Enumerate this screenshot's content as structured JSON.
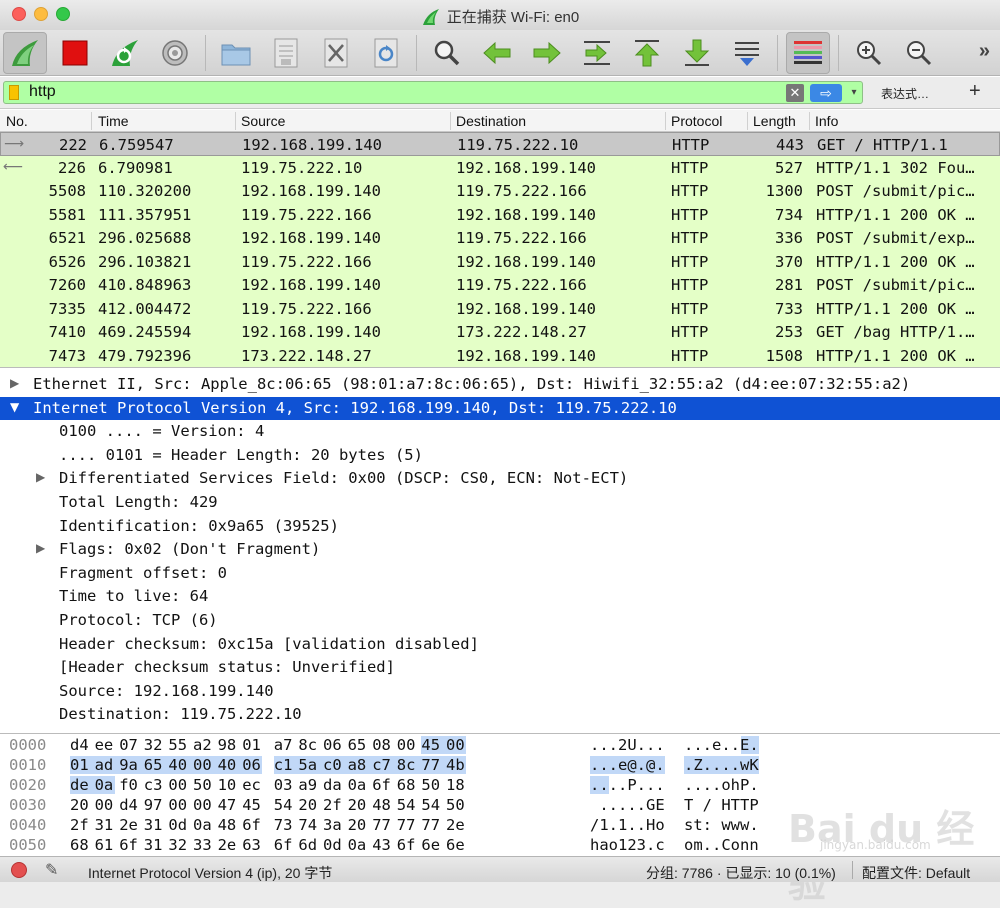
{
  "window": {
    "title": "正在捕获 Wi-Fi: en0"
  },
  "toolbar": {
    "buttons": [
      {
        "name": "start-capture",
        "icon": "shark-fin-icon"
      },
      {
        "name": "stop-capture",
        "icon": "red-square-stop-icon"
      },
      {
        "name": "restart-capture",
        "icon": "restart-fin-icon"
      },
      {
        "name": "capture-options",
        "icon": "gear-icon"
      },
      {
        "name": "open-file",
        "icon": "folder-icon"
      },
      {
        "name": "save-file",
        "icon": "file-save-icon"
      },
      {
        "name": "close-file",
        "icon": "file-close-icon"
      },
      {
        "name": "reload-file",
        "icon": "reload-icon"
      },
      {
        "name": "find-packet",
        "icon": "magnifier-icon"
      },
      {
        "name": "go-back",
        "icon": "arrow-left-icon"
      },
      {
        "name": "go-forward",
        "icon": "arrow-right-icon"
      },
      {
        "name": "go-to-packet",
        "icon": "goto-packet-icon"
      },
      {
        "name": "first-packet",
        "icon": "arrow-top-icon"
      },
      {
        "name": "last-packet",
        "icon": "arrow-bottom-icon"
      },
      {
        "name": "auto-scroll",
        "icon": "autoscroll-icon"
      },
      {
        "name": "colorize",
        "icon": "colorize-icon"
      },
      {
        "name": "zoom-in",
        "icon": "zoom-in-icon"
      },
      {
        "name": "zoom-out",
        "icon": "zoom-out-icon"
      }
    ],
    "more": "»"
  },
  "filter": {
    "value": "http",
    "expression_label": "表达式…",
    "add_label": "+",
    "clear_glyph": "✕",
    "apply_glyph": "⇨",
    "dropdown_glyph": "▾"
  },
  "packet_list": {
    "columns": [
      "No.",
      "Time",
      "Source",
      "Destination",
      "Protocol",
      "Length",
      "Info"
    ],
    "rows": [
      {
        "no": "222",
        "time": "6.759547",
        "src": "192.168.199.140",
        "dst": "119.75.222.10",
        "proto": "HTTP",
        "len": "443",
        "info": "GET / HTTP/1.1",
        "mark": "⟶"
      },
      {
        "no": "226",
        "time": "6.790981",
        "src": "119.75.222.10",
        "dst": "192.168.199.140",
        "proto": "HTTP",
        "len": "527",
        "info": "HTTP/1.1 302 Fou…",
        "mark": "⟵"
      },
      {
        "no": "5508",
        "time": "110.320200",
        "src": "192.168.199.140",
        "dst": "119.75.222.166",
        "proto": "HTTP",
        "len": "1300",
        "info": "POST /submit/pic…",
        "mark": ""
      },
      {
        "no": "5581",
        "time": "111.357951",
        "src": "119.75.222.166",
        "dst": "192.168.199.140",
        "proto": "HTTP",
        "len": "734",
        "info": "HTTP/1.1 200 OK …",
        "mark": ""
      },
      {
        "no": "6521",
        "time": "296.025688",
        "src": "192.168.199.140",
        "dst": "119.75.222.166",
        "proto": "HTTP",
        "len": "336",
        "info": "POST /submit/exp…",
        "mark": ""
      },
      {
        "no": "6526",
        "time": "296.103821",
        "src": "119.75.222.166",
        "dst": "192.168.199.140",
        "proto": "HTTP",
        "len": "370",
        "info": "HTTP/1.1 200 OK …",
        "mark": ""
      },
      {
        "no": "7260",
        "time": "410.848963",
        "src": "192.168.199.140",
        "dst": "119.75.222.166",
        "proto": "HTTP",
        "len": "281",
        "info": "POST /submit/pic…",
        "mark": ""
      },
      {
        "no": "7335",
        "time": "412.004472",
        "src": "119.75.222.166",
        "dst": "192.168.199.140",
        "proto": "HTTP",
        "len": "733",
        "info": "HTTP/1.1 200 OK …",
        "mark": ""
      },
      {
        "no": "7410",
        "time": "469.245594",
        "src": "192.168.199.140",
        "dst": "173.222.148.27",
        "proto": "HTTP",
        "len": "253",
        "info": "GET /bag HTTP/1.…",
        "mark": ""
      },
      {
        "no": "7473",
        "time": "479.792396",
        "src": "173.222.148.27",
        "dst": "192.168.199.140",
        "proto": "HTTP",
        "len": "1508",
        "info": "HTTP/1.1 200 OK …",
        "mark": ""
      }
    ]
  },
  "details": {
    "rows": [
      {
        "arrow": "▶",
        "text": "Ethernet II, Src: Apple_8c:06:65 (98:01:a7:8c:06:65), Dst: Hiwifi_32:55:a2 (d4:ee:07:32:55:a2)",
        "level": 0
      },
      {
        "arrow": "▼",
        "text": "Internet Protocol Version 4, Src: 192.168.199.140, Dst: 119.75.222.10",
        "level": 0
      },
      {
        "arrow": "",
        "text": "0100 .... = Version: 4",
        "level": 1
      },
      {
        "arrow": "",
        "text": ".... 0101 = Header Length: 20 bytes (5)",
        "level": 1
      },
      {
        "arrow": "▶",
        "text": "Differentiated Services Field: 0x00 (DSCP: CS0, ECN: Not-ECT)",
        "level": 1
      },
      {
        "arrow": "",
        "text": "Total Length: 429",
        "level": 1
      },
      {
        "arrow": "",
        "text": "Identification: 0x9a65 (39525)",
        "level": 1
      },
      {
        "arrow": "▶",
        "text": "Flags: 0x02 (Don't Fragment)",
        "level": 1
      },
      {
        "arrow": "",
        "text": "Fragment offset: 0",
        "level": 1
      },
      {
        "arrow": "",
        "text": "Time to live: 64",
        "level": 1
      },
      {
        "arrow": "",
        "text": "Protocol: TCP (6)",
        "level": 1
      },
      {
        "arrow": "",
        "text": "Header checksum: 0xc15a [validation disabled]",
        "level": 1
      },
      {
        "arrow": "",
        "text": "[Header checksum status: Unverified]",
        "level": 1
      },
      {
        "arrow": "",
        "text": "Source: 192.168.199.140",
        "level": 1
      },
      {
        "arrow": "",
        "text": "Destination: 119.75.222.10",
        "level": 1
      }
    ]
  },
  "hex": {
    "rows": [
      {
        "off": "0000",
        "bytes": [
          "d4",
          "ee",
          "07",
          "32",
          "55",
          "a2",
          "98",
          "01",
          "a7",
          "8c",
          "06",
          "65",
          "08",
          "00",
          "45",
          "00"
        ],
        "hl": [
          14,
          15
        ],
        "ascii1": "...2U...",
        "ascii2": "...e..E.",
        "ascii_hl": [
          14,
          15
        ]
      },
      {
        "off": "0010",
        "bytes": [
          "01",
          "ad",
          "9a",
          "65",
          "40",
          "00",
          "40",
          "06",
          "c1",
          "5a",
          "c0",
          "a8",
          "c7",
          "8c",
          "77",
          "4b"
        ],
        "hl": [
          0,
          1,
          2,
          3,
          4,
          5,
          6,
          7,
          8,
          9,
          10,
          11,
          12,
          13,
          14,
          15
        ],
        "ascii1": "...e@.@.",
        "ascii2": ".Z....wK",
        "ascii_hl": [
          0,
          1,
          2,
          3,
          4,
          5,
          6,
          7,
          8,
          9,
          10,
          11,
          12,
          13,
          14,
          15
        ]
      },
      {
        "off": "0020",
        "bytes": [
          "de",
          "0a",
          "f0",
          "c3",
          "00",
          "50",
          "10",
          "ec",
          "03",
          "a9",
          "da",
          "0a",
          "6f",
          "68",
          "50",
          "18"
        ],
        "hl": [
          0,
          1
        ],
        "ascii1": "....P...",
        "ascii2": "....ohP.",
        "ascii_hl": [
          0,
          1
        ]
      },
      {
        "off": "0030",
        "bytes": [
          "20",
          "00",
          "d4",
          "97",
          "00",
          "00",
          "47",
          "45",
          "54",
          "20",
          "2f",
          "20",
          "48",
          "54",
          "54",
          "50"
        ],
        "hl": [],
        "ascii1": " .....GE",
        "ascii2": "T / HTTP",
        "ascii_hl": []
      },
      {
        "off": "0040",
        "bytes": [
          "2f",
          "31",
          "2e",
          "31",
          "0d",
          "0a",
          "48",
          "6f",
          "73",
          "74",
          "3a",
          "20",
          "77",
          "77",
          "77",
          "2e"
        ],
        "hl": [],
        "ascii1": "/1.1..Ho",
        "ascii2": "st: www.",
        "ascii_hl": []
      },
      {
        "off": "0050",
        "bytes": [
          "68",
          "61",
          "6f",
          "31",
          "32",
          "33",
          "2e",
          "63",
          "6f",
          "6d",
          "0d",
          "0a",
          "43",
          "6f",
          "6e",
          "6e"
        ],
        "hl": [],
        "ascii1": "hao123.c",
        "ascii2": "om..Conn",
        "ascii_hl": []
      }
    ]
  },
  "status": {
    "left": "Internet Protocol Version 4 (ip), 20 字节",
    "packets": "分组: 7786 · 已显示: 10 (0.1%)",
    "profile": "配置文件: Default"
  },
  "watermark": {
    "main": "Bai du 经验",
    "sub": "jingyan.baidu.com"
  },
  "colors": {
    "filter_bg": "#b0ffa4",
    "row_bg": "#e4ffc7",
    "selected_detail": "#0f52d4",
    "hex_highlight": "#c1d8f7"
  }
}
